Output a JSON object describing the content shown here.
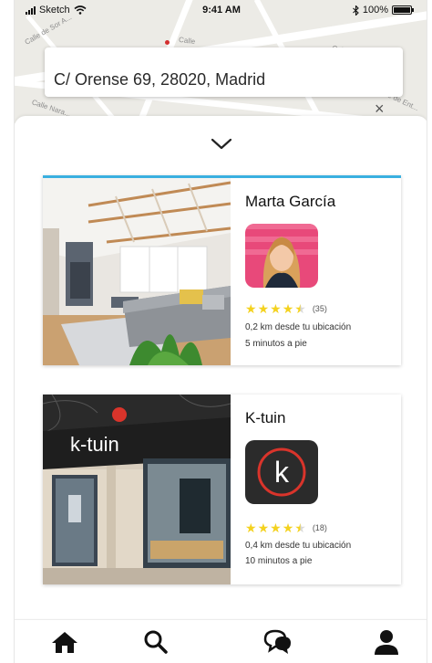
{
  "status_bar": {
    "carrier": "Sketch",
    "time": "9:41 AM",
    "battery": "100%"
  },
  "map": {
    "streets": [
      "Calle de Sor A...",
      "Calle",
      "Calle de la",
      "Calle Nara...",
      "Calle de Ent..."
    ]
  },
  "search": {
    "address_value": "C/ Orense 69, 28020, Madrid"
  },
  "listings": [
    {
      "name": "Marta García",
      "rating": 4.5,
      "review_count": "(35)",
      "distance": "0,2 km desde tu ubicación",
      "walk_time": "5 minutos a pie"
    },
    {
      "name": "K-tuin",
      "logo_text": "k-tuin",
      "logo_letter": "k",
      "rating": 4.5,
      "review_count": "(18)",
      "distance": "0,4 km desde tu ubicación",
      "walk_time": "10 minutos a pie"
    }
  ],
  "icons": {
    "home": "home-icon",
    "search": "search-icon",
    "chat": "chat-icon",
    "profile": "profile-icon"
  },
  "colors": {
    "accent": "#3ab0e0",
    "star": "#f4d21f",
    "logo_red": "#d9342b"
  }
}
